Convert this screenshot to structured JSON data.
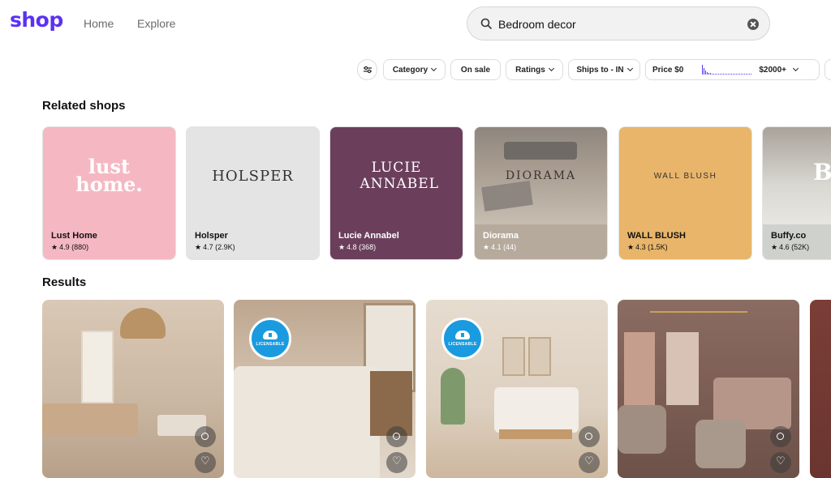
{
  "header": {
    "logo": "shop",
    "nav": [
      "Home",
      "Explore"
    ],
    "search_value": "Bedroom decor"
  },
  "filters": {
    "category": "Category",
    "on_sale": "On sale",
    "ratings": "Ratings",
    "ships_to": "Ships to - IN",
    "price_label": "Price $0",
    "price_max": "$2000+"
  },
  "related_shops": {
    "title": "Related shops",
    "shops": [
      {
        "name": "Lust Home",
        "rating": "4.9 (880)",
        "logo_text": "lust home.",
        "bg": "#f5b8c2",
        "fg": "#ffffff"
      },
      {
        "name": "Holsper",
        "rating": "4.7 (2.9K)",
        "logo_text": "HOLSPER",
        "bg": "#e4e4e4",
        "fg": "#333333"
      },
      {
        "name": "Lucie Annabel",
        "rating": "4.8 (368)",
        "logo_text": "LUCIE ANNABEL",
        "bg": "#6b3f5c",
        "fg": "#ffffff"
      },
      {
        "name": "Diorama",
        "rating": "4.1 (44)",
        "logo_text": "DIORAMA",
        "bg": "#b6aa9d",
        "fg": "#3a3530"
      },
      {
        "name": "WALL BLUSH",
        "rating": "4.3 (1.5K)",
        "logo_text": "WALL BLUSH",
        "bg": "#e8b56a",
        "fg": "#333333"
      },
      {
        "name": "Buffy.co",
        "rating": "4.6 (52K)",
        "logo_text": "Bu",
        "bg": "#cfd2cc",
        "fg": "#ffffff"
      }
    ]
  },
  "results": {
    "title": "Results",
    "badge_text": "LICENSABLE"
  },
  "colors": {
    "brand": "#5a31f4",
    "badge": "#1a9be0"
  }
}
